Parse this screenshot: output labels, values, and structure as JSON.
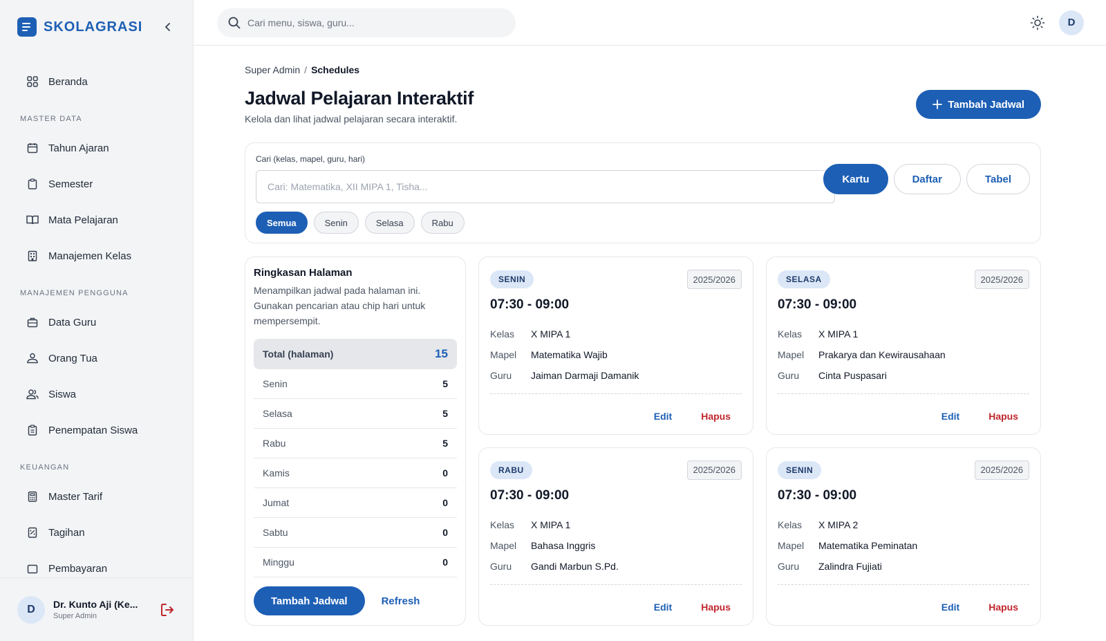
{
  "brand": {
    "name": "SKOLAGRASI"
  },
  "sidebar": {
    "home": "Beranda",
    "sections": [
      {
        "title": "MASTER DATA",
        "items": [
          "Tahun Ajaran",
          "Semester",
          "Mata Pelajaran",
          "Manajemen Kelas"
        ]
      },
      {
        "title": "MANAJEMEN PENGGUNA",
        "items": [
          "Data Guru",
          "Orang Tua",
          "Siswa",
          "Penempatan Siswa"
        ]
      },
      {
        "title": "KEUANGAN",
        "items": [
          "Master Tarif",
          "Tagihan",
          "Pembayaran"
        ]
      }
    ]
  },
  "user": {
    "initial": "D",
    "name": "Dr. Kunto Aji (Ke...",
    "role": "Super Admin"
  },
  "topbar": {
    "search_placeholder": "Cari menu, siswa, guru...",
    "avatar_initial": "D"
  },
  "breadcrumb": {
    "root": "Super Admin",
    "sep": "/",
    "current": "Schedules"
  },
  "page": {
    "title": "Jadwal Pelajaran Interaktif",
    "subtitle": "Kelola dan lihat jadwal pelajaran secara interaktif.",
    "add_button": "Tambah Jadwal"
  },
  "filter": {
    "label": "Cari (kelas, mapel, guru, hari)",
    "placeholder": "Cari: Matematika, XII MIPA 1, Tisha...",
    "views": [
      "Kartu",
      "Daftar",
      "Tabel"
    ],
    "chips": [
      "Semua",
      "Senin",
      "Selasa",
      "Rabu"
    ]
  },
  "summary": {
    "title": "Ringkasan Halaman",
    "desc": "Menampilkan jadwal pada halaman ini. Gunakan pencarian atau chip hari untuk mempersempit.",
    "total_label": "Total (halaman)",
    "total_value": "15",
    "rows": [
      {
        "label": "Senin",
        "value": "5"
      },
      {
        "label": "Selasa",
        "value": "5"
      },
      {
        "label": "Rabu",
        "value": "5"
      },
      {
        "label": "Kamis",
        "value": "0"
      },
      {
        "label": "Jumat",
        "value": "0"
      },
      {
        "label": "Sabtu",
        "value": "0"
      },
      {
        "label": "Minggu",
        "value": "0"
      }
    ],
    "add_button": "Tambah Jadwal",
    "refresh": "Refresh"
  },
  "card_labels": {
    "kelas": "Kelas",
    "mapel": "Mapel",
    "guru": "Guru",
    "edit": "Edit",
    "delete": "Hapus"
  },
  "cards": [
    {
      "day": "SENIN",
      "year": "2025/2026",
      "time": "07:30 - 09:00",
      "kelas": "X MIPA 1",
      "mapel": "Matematika Wajib",
      "guru": "Jaiman Darmaji Damanik"
    },
    {
      "day": "SELASA",
      "year": "2025/2026",
      "time": "07:30 - 09:00",
      "kelas": "X MIPA 1",
      "mapel": "Prakarya dan Kewirausahaan",
      "guru": "Cinta Puspasari"
    },
    {
      "day": "RABU",
      "year": "2025/2026",
      "time": "07:30 - 09:00",
      "kelas": "X MIPA 1",
      "mapel": "Bahasa Inggris",
      "guru": "Gandi Marbun S.Pd."
    },
    {
      "day": "SENIN",
      "year": "2025/2026",
      "time": "07:30 - 09:00",
      "kelas": "X MIPA 2",
      "mapel": "Matematika Peminatan",
      "guru": "Zalindra Fujiati"
    }
  ]
}
